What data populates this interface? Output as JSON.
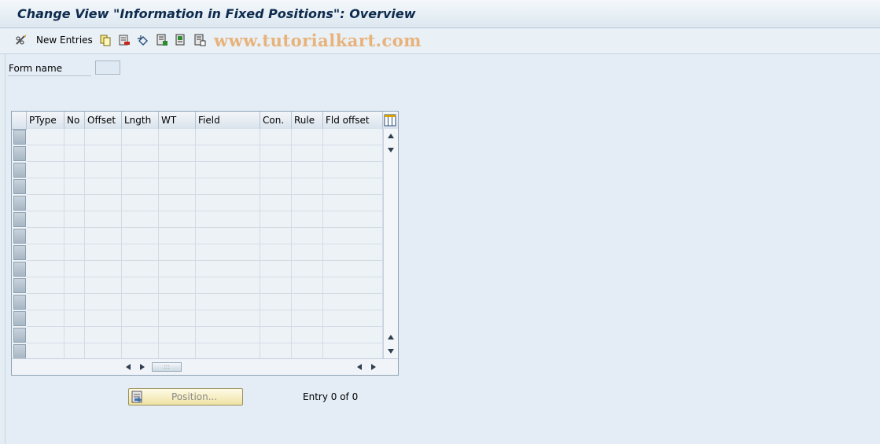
{
  "title": "Change View \"Information in Fixed Positions\": Overview",
  "toolbar": {
    "new_entries_label": "New Entries",
    "watermark": "www.tutorialkart.com",
    "icons": [
      "pencil-glasses-icon",
      "copy-icon",
      "delete-icon",
      "undo-icon",
      "select-all-icon",
      "select-block-icon",
      "deselect-all-icon"
    ]
  },
  "form": {
    "form_name_label": "Form name",
    "form_name_value": ""
  },
  "table": {
    "columns": [
      "PType",
      "No",
      "Offset",
      "Lngth",
      "WT",
      "Field",
      "Con.",
      "Rule",
      "Fld offset"
    ],
    "rows": [
      [
        "",
        "",
        "",
        "",
        "",
        "",
        "",
        "",
        ""
      ],
      [
        "",
        "",
        "",
        "",
        "",
        "",
        "",
        "",
        ""
      ],
      [
        "",
        "",
        "",
        "",
        "",
        "",
        "",
        "",
        ""
      ],
      [
        "",
        "",
        "",
        "",
        "",
        "",
        "",
        "",
        ""
      ],
      [
        "",
        "",
        "",
        "",
        "",
        "",
        "",
        "",
        ""
      ],
      [
        "",
        "",
        "",
        "",
        "",
        "",
        "",
        "",
        ""
      ],
      [
        "",
        "",
        "",
        "",
        "",
        "",
        "",
        "",
        ""
      ],
      [
        "",
        "",
        "",
        "",
        "",
        "",
        "",
        "",
        ""
      ],
      [
        "",
        "",
        "",
        "",
        "",
        "",
        "",
        "",
        ""
      ],
      [
        "",
        "",
        "",
        "",
        "",
        "",
        "",
        "",
        ""
      ],
      [
        "",
        "",
        "",
        "",
        "",
        "",
        "",
        "",
        ""
      ],
      [
        "",
        "",
        "",
        "",
        "",
        "",
        "",
        "",
        ""
      ],
      [
        "",
        "",
        "",
        "",
        "",
        "",
        "",
        "",
        ""
      ],
      [
        "",
        "",
        "",
        "",
        "",
        "",
        "",
        "",
        ""
      ]
    ]
  },
  "footer": {
    "position_button_label": "Position...",
    "entry_text": "Entry 0 of 0"
  },
  "colors": {
    "background": "#e5edf4",
    "title_text": "#0d2b4d",
    "watermark": "#e8b27a",
    "button_bg": "#f5edc5"
  }
}
